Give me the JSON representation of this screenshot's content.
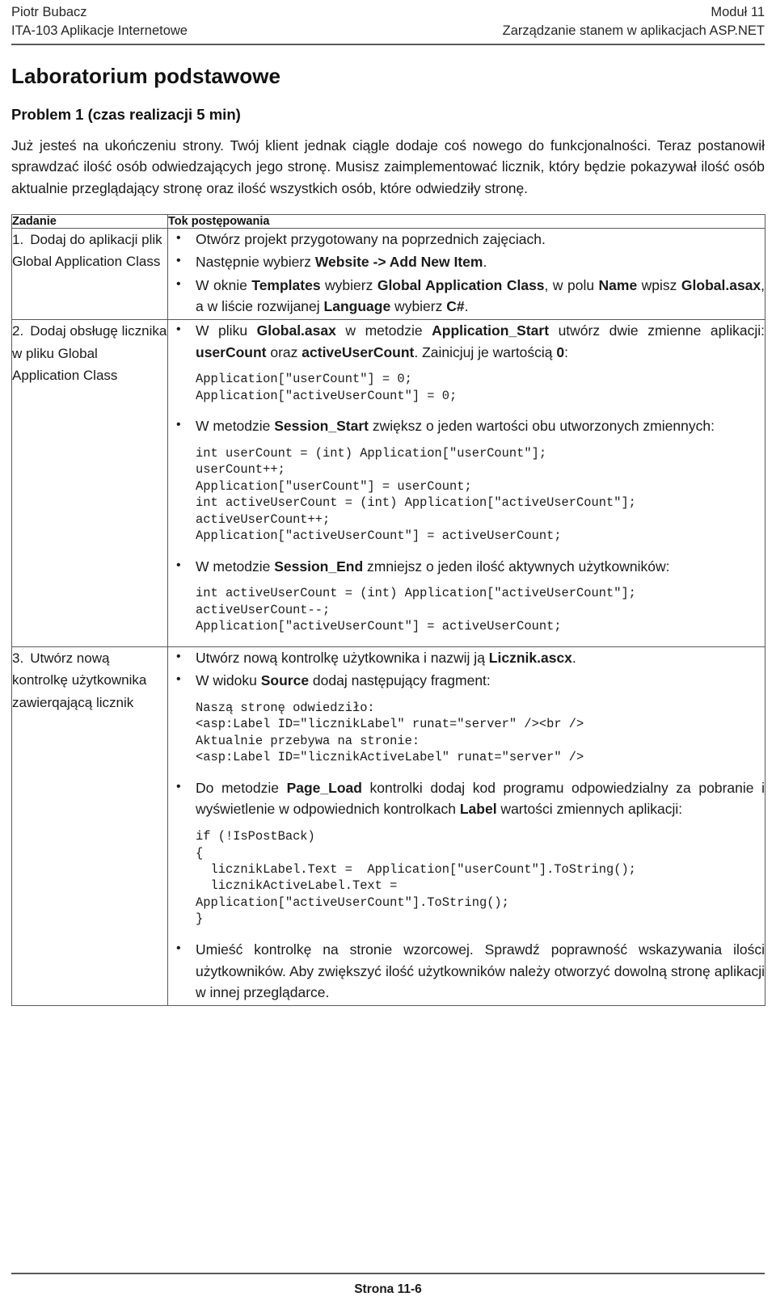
{
  "header": {
    "author": "Piotr Bubacz",
    "course": "ITA-103 Aplikacje Internetowe",
    "module": "Moduł 11",
    "module_title": "Zarządzanie stanem w aplikacjach ASP.NET"
  },
  "title": "Laboratorium podstawowe",
  "problem_title": "Problem 1 (czas realizacji 5 min)",
  "intro": "Już jesteś na ukończeniu strony. Twój klient jednak ciągle dodaje coś nowego do funkcjonalności. Teraz postanowił sprawdzać ilość osób odwiedzających jego stronę. Musisz zaimplementować licznik, który będzie pokazywał ilość osób aktualnie przeglądający stronę oraz ilość wszystkich osób, które odwiedziły stronę.",
  "table": {
    "headers": {
      "task": "Zadanie",
      "steps": "Tok postępowania"
    },
    "rows": [
      {
        "number": "1.",
        "task": "Dodaj do aplikacji plik Global Application Class",
        "steps": [
          {
            "kind": "bullet",
            "html": "Otwórz projekt przygotowany na poprzednich zajęciach.",
            "align": "left"
          },
          {
            "kind": "bullet",
            "html": "Następnie wybierz <b class=\"bd\">Website -&gt; Add New Item</b>.",
            "align": "left"
          },
          {
            "kind": "bullet",
            "html": "W oknie <b class=\"bd\">Templates</b> wybierz <b class=\"bd\">Global Application Class</b>, w polu <b class=\"bd\">Name</b> wpisz <b class=\"bd\">Global.asax</b>, a w liście rozwijanej <b class=\"bd\">Language</b> wybierz <b class=\"bd\">C#</b>.",
            "align": "justify"
          }
        ]
      },
      {
        "number": "2.",
        "task": "Dodaj obsługę licznika w pliku Global Application Class",
        "steps": [
          {
            "kind": "bullet",
            "html": "W pliku <b class=\"bd\">Global.asax</b> w metodzie <b class=\"bd\">Application_Start</b> utwórz dwie zmienne aplikacji: <b class=\"bd\">userCount</b> oraz <b class=\"bd\">activeUserCount</b>. Zainicjuj je wartością <b class=\"bd\">0</b>:",
            "align": "justify"
          },
          {
            "kind": "code",
            "text": "Application[\"userCount\"] = 0;\nApplication[\"activeUserCount\"] = 0;"
          },
          {
            "kind": "bullet",
            "html": "W metodzie <b class=\"bd\">Session_Start</b> zwiększ o jeden wartości obu utworzonych zmiennych:",
            "align": "justify"
          },
          {
            "kind": "code",
            "text": "int userCount = (int) Application[\"userCount\"];\nuserCount++;\nApplication[\"userCount\"] = userCount;\nint activeUserCount = (int) Application[\"activeUserCount\"];\nactiveUserCount++;\nApplication[\"activeUserCount\"] = activeUserCount;"
          },
          {
            "kind": "bullet",
            "html": "W metodzie <b class=\"bd\">Session_End</b> zmniejsz o jeden ilość aktywnych użytkowników:",
            "align": "justify"
          },
          {
            "kind": "code",
            "text": "int activeUserCount = (int) Application[\"activeUserCount\"];\nactiveUserCount--;\nApplication[\"activeUserCount\"] = activeUserCount;"
          }
        ]
      },
      {
        "number": "3.",
        "task": "Utwórz nową kontrolkę użytkownika zawierqającą licznik",
        "steps": [
          {
            "kind": "bullet",
            "html": "Utwórz nową kontrolkę użytkownika i nazwij ją <b class=\"bd\">Licznik.ascx</b>.",
            "align": "left"
          },
          {
            "kind": "bullet",
            "html": "W widoku <b class=\"bd\">Source</b> dodaj następujący fragment:",
            "align": "left"
          },
          {
            "kind": "code",
            "text": "Naszą stronę odwiedziło:\n<asp:Label ID=\"licznikLabel\" runat=\"server\" /><br />\nAktualnie przebywa na stronie:\n<asp:Label ID=\"licznikActiveLabel\" runat=\"server\" />"
          },
          {
            "kind": "bullet",
            "html": "Do metodzie <b class=\"bd\">Page_Load</b> kontrolki dodaj kod programu odpowiedzialny za pobranie i wyświetlenie w odpowiednich kontrolkach <b class=\"bd\">Label</b> wartości zmiennych aplikacji:",
            "align": "justify"
          },
          {
            "kind": "code",
            "text": "if (!IsPostBack)\n{\n  licznikLabel.Text =  Application[\"userCount\"].ToString();\n  licznikActiveLabel.Text =\nApplication[\"activeUserCount\"].ToString();\n}"
          },
          {
            "kind": "bullet",
            "html": "Umieść kontrolkę na stronie wzorcowej. Sprawdź poprawność wskazywania ilości użytkowników. Aby zwiększyć ilość użytkowników należy otworzyć dowolną stronę aplikacji w innej przeglądarce.",
            "align": "justify"
          }
        ]
      }
    ]
  },
  "footer": {
    "page_label": "Strona 11-6"
  }
}
